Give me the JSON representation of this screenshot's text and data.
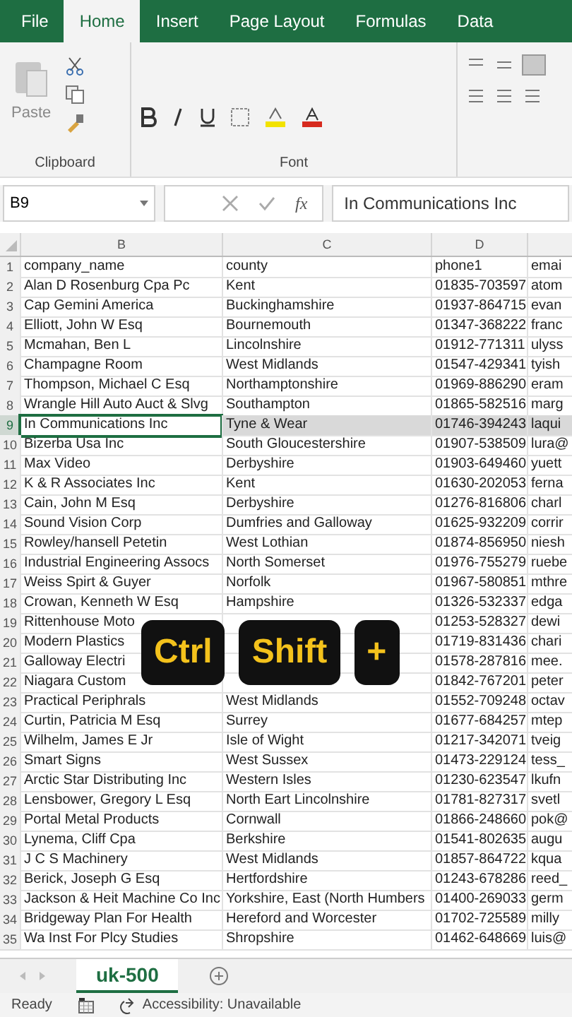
{
  "ribbon_tabs": [
    {
      "label": "File",
      "selected": false
    },
    {
      "label": "Home",
      "selected": true
    },
    {
      "label": "Insert",
      "selected": false
    },
    {
      "label": "Page Layout",
      "selected": false
    },
    {
      "label": "Formulas",
      "selected": false
    },
    {
      "label": "Data",
      "selected": false
    }
  ],
  "ribbon": {
    "paste_label": "Paste",
    "groups": [
      "Clipboard",
      "Font"
    ]
  },
  "formula_bar": {
    "name_box": "B9",
    "fx": "fx",
    "value": "In Communications Inc"
  },
  "sheet": {
    "columns": [
      "B",
      "C",
      "D"
    ],
    "rows": [
      {
        "num": "1",
        "cells": [
          "company_name",
          "county",
          "phone1",
          "emai"
        ],
        "selected": false
      },
      {
        "num": "2",
        "cells": [
          "Alan D Rosenburg Cpa Pc",
          "Kent",
          "01835-703597",
          "atom"
        ],
        "selected": false
      },
      {
        "num": "3",
        "cells": [
          "Cap Gemini America",
          "Buckinghamshire",
          "01937-864715",
          "evan"
        ],
        "selected": false
      },
      {
        "num": "4",
        "cells": [
          "Elliott, John W Esq",
          "Bournemouth",
          "01347-368222",
          "franc"
        ],
        "selected": false
      },
      {
        "num": "5",
        "cells": [
          "Mcmahan, Ben L",
          "Lincolnshire",
          "01912-771311",
          "ulyss"
        ],
        "selected": false
      },
      {
        "num": "6",
        "cells": [
          "Champagne Room",
          "West Midlands",
          "01547-429341",
          "tyish"
        ],
        "selected": false
      },
      {
        "num": "7",
        "cells": [
          "Thompson, Michael C Esq",
          "Northamptonshire",
          "01969-886290",
          "eram"
        ],
        "selected": false
      },
      {
        "num": "8",
        "cells": [
          "Wrangle Hill Auto Auct & Slvg",
          "Southampton",
          "01865-582516",
          "marg"
        ],
        "selected": false
      },
      {
        "num": "9",
        "cells": [
          "In Communications Inc",
          "Tyne & Wear",
          "01746-394243",
          "laqui"
        ],
        "selected": true
      },
      {
        "num": "10",
        "cells": [
          "Bizerba Usa Inc",
          "South Gloucestershire",
          "01907-538509",
          "lura@"
        ],
        "selected": false
      },
      {
        "num": "11",
        "cells": [
          "Max Video",
          "Derbyshire",
          "01903-649460",
          "yuett"
        ],
        "selected": false
      },
      {
        "num": "12",
        "cells": [
          "K & R Associates Inc",
          "Kent",
          "01630-202053",
          "ferna"
        ],
        "selected": false
      },
      {
        "num": "13",
        "cells": [
          "Cain, John M Esq",
          "Derbyshire",
          "01276-816806",
          "charl"
        ],
        "selected": false
      },
      {
        "num": "14",
        "cells": [
          "Sound Vision Corp",
          "Dumfries and Galloway",
          "01625-932209",
          "corrir"
        ],
        "selected": false
      },
      {
        "num": "15",
        "cells": [
          "Rowley/hansell Petetin",
          "West Lothian",
          "01874-856950",
          "niesh"
        ],
        "selected": false
      },
      {
        "num": "16",
        "cells": [
          "Industrial Engineering Assocs",
          "North Somerset",
          "01976-755279",
          "ruebe"
        ],
        "selected": false
      },
      {
        "num": "17",
        "cells": [
          "Weiss Spirt & Guyer",
          "Norfolk",
          "01967-580851",
          "mthre"
        ],
        "selected": false
      },
      {
        "num": "18",
        "cells": [
          "Crowan, Kenneth W Esq",
          "Hampshire",
          "01326-532337",
          "edga"
        ],
        "selected": false
      },
      {
        "num": "19",
        "cells": [
          "Rittenhouse Moto",
          "",
          "01253-528327",
          "dewi"
        ],
        "selected": false
      },
      {
        "num": "20",
        "cells": [
          "Modern Plastics",
          "",
          "01719-831436",
          "chari"
        ],
        "selected": false
      },
      {
        "num": "21",
        "cells": [
          "Galloway Electri",
          "",
          "01578-287816",
          "mee."
        ],
        "selected": false
      },
      {
        "num": "22",
        "cells": [
          "Niagara Custom",
          "",
          "01842-767201",
          "peter"
        ],
        "selected": false
      },
      {
        "num": "23",
        "cells": [
          "Practical Periphrals",
          "West Midlands",
          "01552-709248",
          "octav"
        ],
        "selected": false
      },
      {
        "num": "24",
        "cells": [
          "Curtin, Patricia M Esq",
          "Surrey",
          "01677-684257",
          "mtep"
        ],
        "selected": false
      },
      {
        "num": "25",
        "cells": [
          "Wilhelm, James E Jr",
          "Isle of Wight",
          "01217-342071",
          "tveig"
        ],
        "selected": false
      },
      {
        "num": "26",
        "cells": [
          "Smart Signs",
          "West Sussex",
          "01473-229124",
          "tess_"
        ],
        "selected": false
      },
      {
        "num": "27",
        "cells": [
          "Arctic Star Distributing Inc",
          "Western Isles",
          "01230-623547",
          "lkufn"
        ],
        "selected": false
      },
      {
        "num": "28",
        "cells": [
          "Lensbower, Gregory L Esq",
          "North Eart Lincolnshire",
          "01781-827317",
          "svetl"
        ],
        "selected": false
      },
      {
        "num": "29",
        "cells": [
          "Portal Metal Products",
          "Cornwall",
          "01866-248660",
          "pok@"
        ],
        "selected": false
      },
      {
        "num": "30",
        "cells": [
          "Lynema, Cliff Cpa",
          "Berkshire",
          "01541-802635",
          "augu"
        ],
        "selected": false
      },
      {
        "num": "31",
        "cells": [
          "J C S Machinery",
          "West Midlands",
          "01857-864722",
          "kqua"
        ],
        "selected": false
      },
      {
        "num": "32",
        "cells": [
          "Berick, Joseph G Esq",
          "Hertfordshire",
          "01243-678286",
          "reed_"
        ],
        "selected": false
      },
      {
        "num": "33",
        "cells": [
          "Jackson & Heit Machine Co Inc",
          "Yorkshire, East (North Humbers",
          "01400-269033",
          "germ"
        ],
        "selected": false
      },
      {
        "num": "34",
        "cells": [
          "Bridgeway Plan For Health",
          "Hereford and Worcester",
          "01702-725589",
          "milly"
        ],
        "selected": false
      },
      {
        "num": "35",
        "cells": [
          "Wa Inst For Plcy Studies",
          "Shropshire",
          "01462-648669",
          "luis@"
        ],
        "selected": false
      }
    ]
  },
  "shortcut_keys": [
    "Ctrl",
    "Shift",
    "+"
  ],
  "sheet_tab": "uk-500",
  "status_bar": {
    "status": "Ready",
    "accessibility": "Accessibility: Unavailable"
  }
}
